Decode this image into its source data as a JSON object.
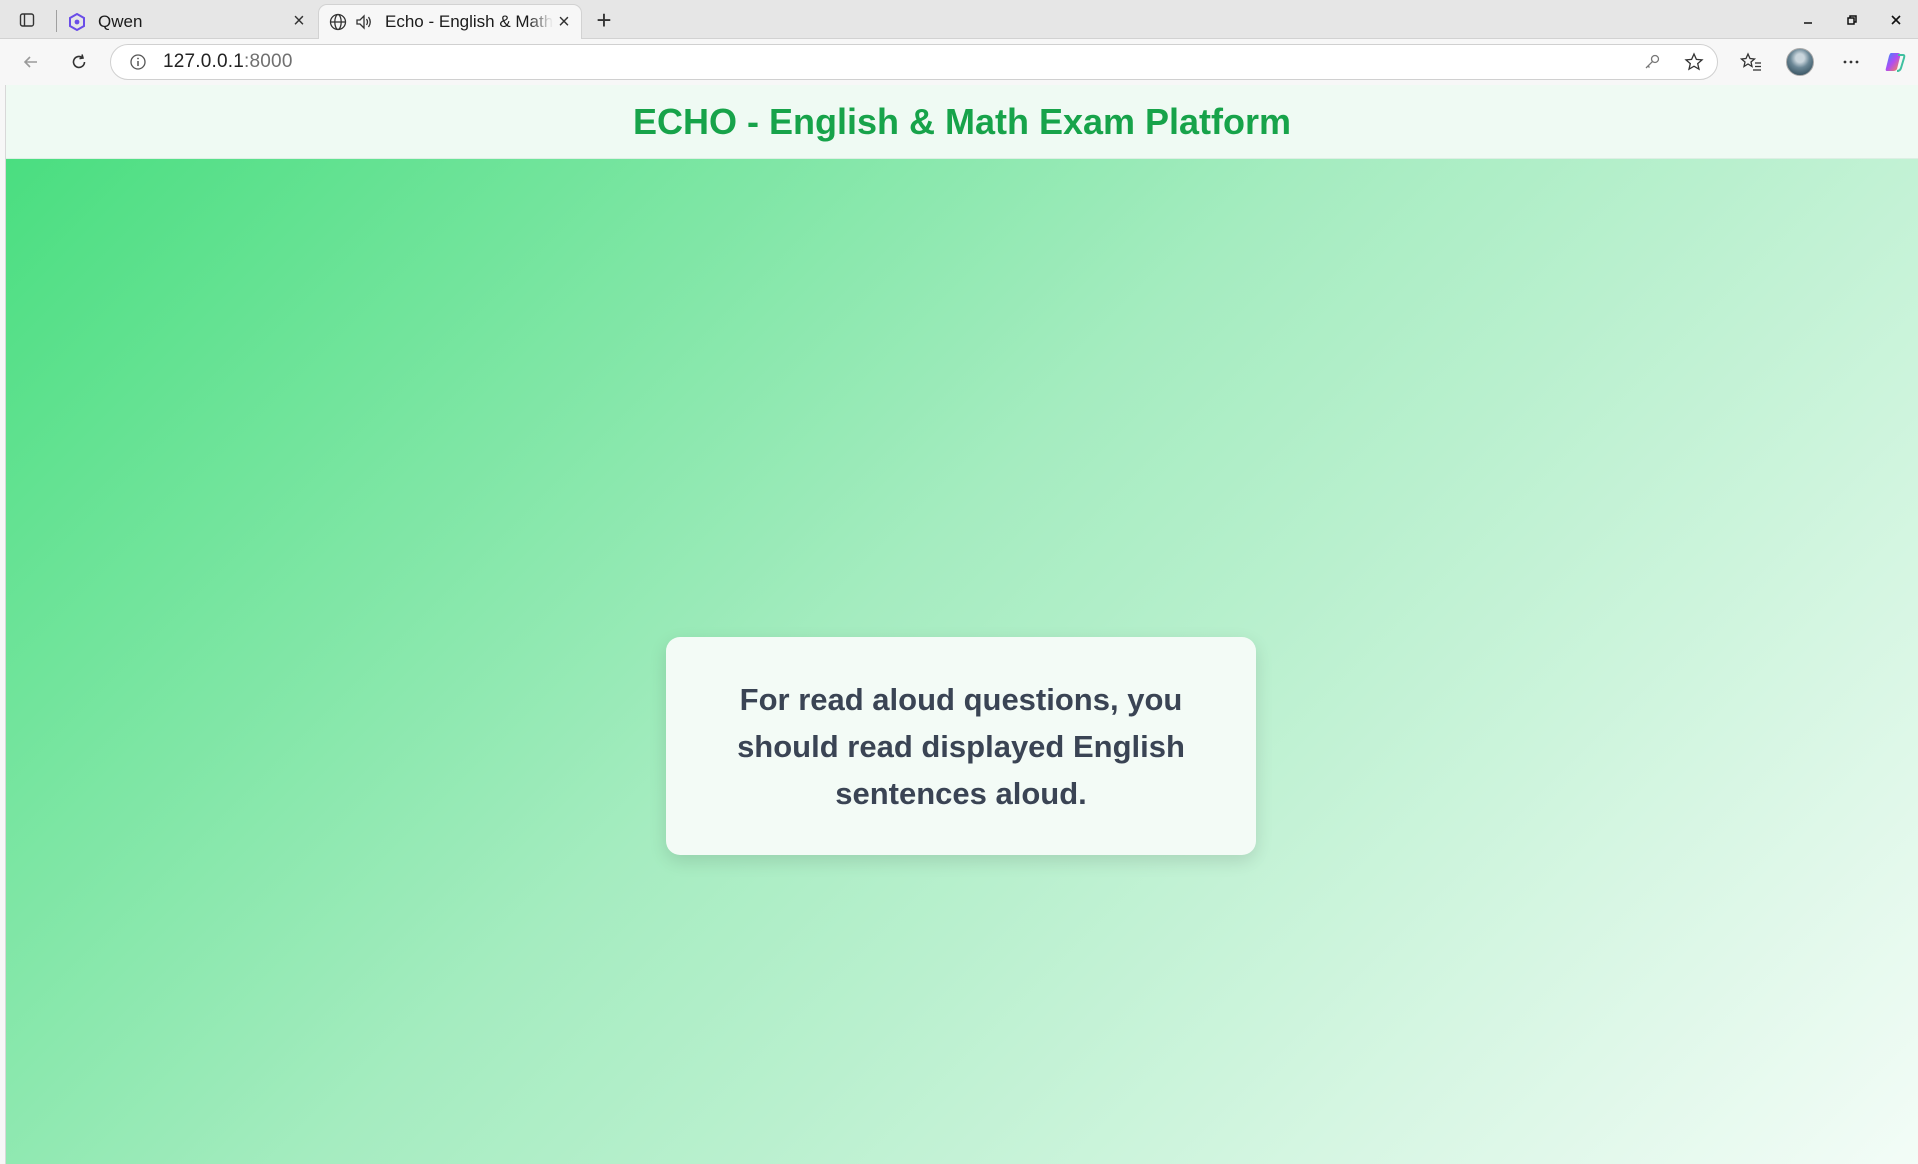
{
  "browser": {
    "tabs": [
      {
        "title": "Qwen",
        "favicon": "qwen-logo-icon",
        "active": false
      },
      {
        "title": "Echo - English & Math Exam Platform",
        "favicon": "globe-icon",
        "audio": "speaker-icon",
        "active": true
      }
    ],
    "address": {
      "host": "127.0.0.1",
      "port": ":8000"
    },
    "icons": [
      "tab-actions-icon",
      "close-icon",
      "new-tab-icon",
      "minimize-icon",
      "restore-icon",
      "back-icon",
      "refresh-icon",
      "info-icon",
      "key-icon",
      "star-icon",
      "favorites-icon",
      "more-icon",
      "copilot-icon"
    ]
  },
  "page": {
    "header_title": "ECHO - English & Math Exam Platform",
    "instruction": "For read aloud questions, you should read displayed English sentences aloud."
  },
  "colors": {
    "title_green": "#17a34a",
    "gradient_start": "#4ade80",
    "gradient_end": "#f3fcf7",
    "card_text": "#3a4454"
  }
}
